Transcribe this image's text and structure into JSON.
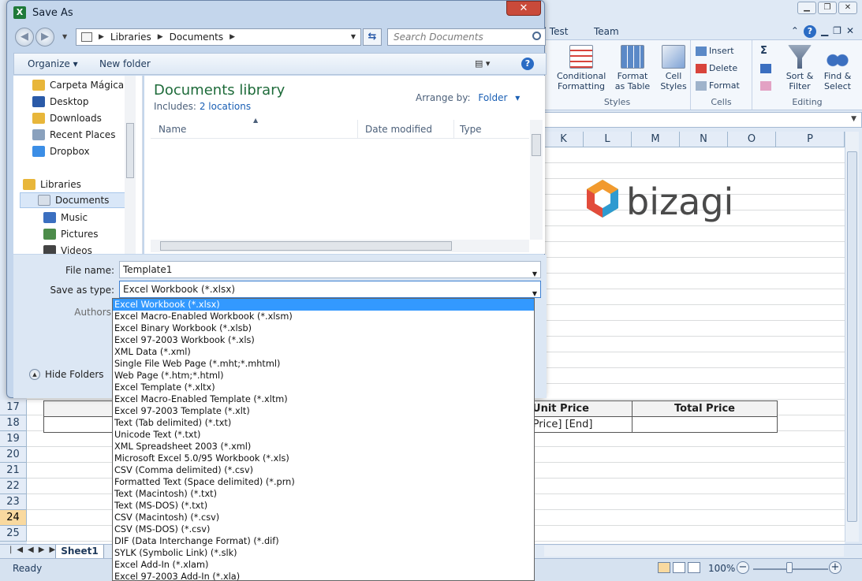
{
  "excel": {
    "ribbon_tabs": [
      "ad Test",
      "Team"
    ],
    "ribbon_groups": {
      "styles": {
        "label": "Styles",
        "conditional_formatting": [
          "Conditional",
          "Formatting"
        ],
        "format_as_table": [
          "Format",
          "as Table"
        ],
        "cell_styles": [
          "Cell",
          "Styles"
        ]
      },
      "cells": {
        "label": "Cells",
        "insert": "Insert",
        "delete": "Delete",
        "format": "Format"
      },
      "editing": {
        "label": "Editing",
        "sort_filter": [
          "Sort &",
          "Filter"
        ],
        "find_select": [
          "Find &",
          "Select"
        ],
        "sigma": "Σ"
      }
    },
    "columns": [
      "K",
      "L",
      "M",
      "N",
      "O",
      "P"
    ],
    "rows": [
      "17",
      "18",
      "19",
      "20",
      "21",
      "22",
      "23",
      "24",
      "25"
    ],
    "selected_row": "24",
    "table": {
      "headers": [
        "Unit Price",
        "Total Price"
      ],
      "row1": [
        "[Price] [End]",
        ""
      ]
    },
    "logo_text": "bizagi",
    "sheet_tab": "Sheet1",
    "status": "Ready",
    "zoom": "100%",
    "zoom_minus": "−",
    "zoom_plus": "+"
  },
  "dialog": {
    "title": "Save As",
    "close_label": "✕",
    "address": [
      "Libraries",
      "Documents"
    ],
    "search_placeholder": "Search Documents",
    "toolbar": {
      "organize": "Organize ▾",
      "new_folder": "New folder",
      "views": "▤ ▾",
      "help": "?"
    },
    "nav_items": [
      {
        "label": "Carpeta Mágica",
        "color": "#e8b63a"
      },
      {
        "label": "Desktop",
        "color": "#2a5aa8"
      },
      {
        "label": "Downloads",
        "color": "#e8b63a"
      },
      {
        "label": "Recent Places",
        "color": "#8aa1bd"
      },
      {
        "label": "Dropbox",
        "color": "#3b8ee6"
      },
      {
        "label": "Libraries",
        "color": "#e8b63a"
      },
      {
        "label": "Documents",
        "color": "#d7dfe9"
      },
      {
        "label": "Music",
        "color": "#3b6fc0"
      },
      {
        "label": "Pictures",
        "color": "#4c8c4a"
      },
      {
        "label": "Videos",
        "color": "#444444"
      }
    ],
    "library": {
      "title": "Documents library",
      "includes_label": "Includes:",
      "includes_link": "2 locations",
      "arrange_label": "Arrange by:",
      "arrange_value": "Folder"
    },
    "columns": [
      "Name",
      "Date modified",
      "Type"
    ],
    "file_name_label": "File name:",
    "file_name_value": "Template1",
    "save_type_label": "Save as type:",
    "save_type_value": "Excel Workbook (*.xlsx)",
    "authors_label": "Authors:",
    "hide_folders": "Hide Folders",
    "type_options": [
      "Excel Workbook (*.xlsx)",
      "Excel Macro-Enabled Workbook (*.xlsm)",
      "Excel Binary Workbook (*.xlsb)",
      "Excel 97-2003 Workbook (*.xls)",
      "XML Data (*.xml)",
      "Single File Web Page (*.mht;*.mhtml)",
      "Web Page (*.htm;*.html)",
      "Excel Template (*.xltx)",
      "Excel Macro-Enabled Template (*.xltm)",
      "Excel 97-2003 Template (*.xlt)",
      "Text (Tab delimited) (*.txt)",
      "Unicode Text (*.txt)",
      "XML Spreadsheet 2003 (*.xml)",
      "Microsoft Excel 5.0/95 Workbook (*.xls)",
      "CSV (Comma delimited) (*.csv)",
      "Formatted Text (Space delimited) (*.prn)",
      "Text (Macintosh) (*.txt)",
      "Text (MS-DOS) (*.txt)",
      "CSV (Macintosh) (*.csv)",
      "CSV (MS-DOS) (*.csv)",
      "DIF (Data Interchange Format) (*.dif)",
      "SYLK (Symbolic Link) (*.slk)",
      "Excel Add-In (*.xlam)",
      "Excel 97-2003 Add-In (*.xla)"
    ]
  }
}
